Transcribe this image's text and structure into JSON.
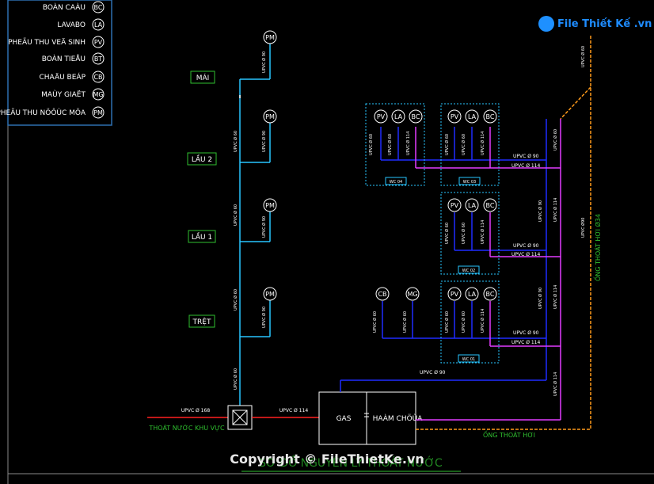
{
  "legend": [
    {
      "label": "BOÀN CAÀU",
      "sym": "BC"
    },
    {
      "label": "LAVABO",
      "sym": "LA"
    },
    {
      "label": "PHEÃU THU VEÄ SINH",
      "sym": "PV"
    },
    {
      "label": "BOÀN TIEÅU",
      "sym": "BT"
    },
    {
      "label": "CHAÄU BEÁP",
      "sym": "CB"
    },
    {
      "label": "MAÙY GIAËT",
      "sym": "MG"
    },
    {
      "label": "PHEÃU THU NÖÔÙC MÖA",
      "sym": "PM"
    }
  ],
  "floors": [
    "MÁI",
    "LẦU 2",
    "LẦU 1",
    "TRỆT"
  ],
  "riser_symbol": "PM",
  "pipe_labels": {
    "upvc60": "UPVC Ø 60",
    "upvc90": "UPVC Ø 90",
    "upvc114": "UPVC Ø 114",
    "upvc168": "UPVC Ø 168",
    "upvc34": "UPVC Ø 34"
  },
  "wc_labels": [
    "WC 04",
    "WC 03",
    "WC 02",
    "WC 01"
  ],
  "fixtures": {
    "pv": "PV",
    "la": "LA",
    "bc": "BC",
    "cb": "CB",
    "mg": "MG"
  },
  "tank": {
    "left": "GAS",
    "right": "HAÀM CHÖÙA"
  },
  "labels": {
    "drain_out": "THOÁT NƯỚC KHU VỰC",
    "vent_pipe": "ỐNG THOÁT HƠI",
    "vent_pipe_vertical": "ỐNG THOÁT HƠI Ø34",
    "upvc_vertical_vent": "UPVC Ø90"
  },
  "footer": {
    "title": "SƠ ĐỒ NGUYÊN LÝ THOÁT NƯỚC",
    "copyright": "Copyright © FileThietKe.vn"
  },
  "logo": {
    "text": "File Thiết Kế .vn"
  },
  "colors": {
    "cyan": "#29c6ff",
    "blue": "#1f2cff",
    "magenta": "#e23cff",
    "red": "#ff2020",
    "orange": "#ff9a1a",
    "green": "#2fbf2f",
    "white": "#ffffff"
  }
}
